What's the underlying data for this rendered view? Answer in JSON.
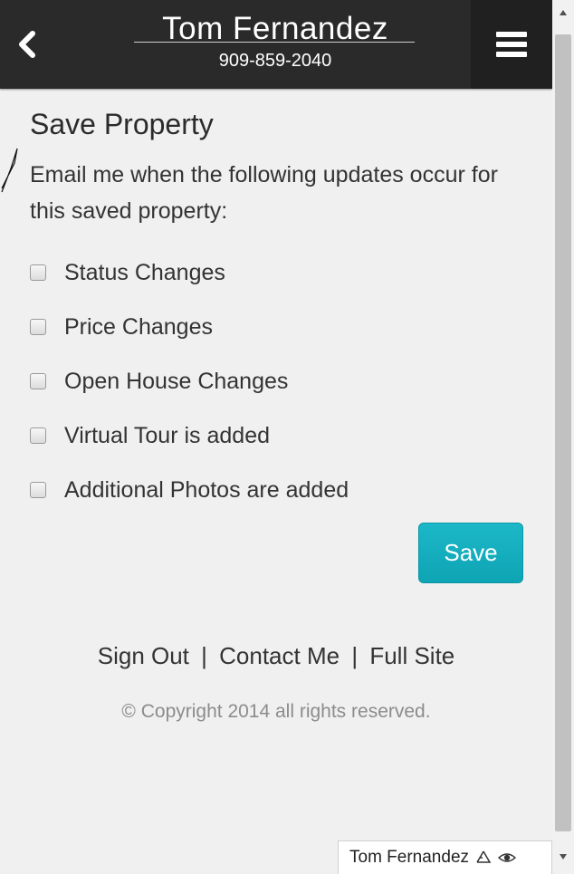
{
  "header": {
    "agent_name": "Tom Fernandez",
    "agent_phone": "909-859-2040",
    "back_icon": "chevron-left-icon",
    "menu_icon": "hamburger-icon"
  },
  "main": {
    "title": "Save Property",
    "intro": "Email me when the following updates occur for this saved property:",
    "options": [
      {
        "label": "Status Changes",
        "checked": false
      },
      {
        "label": "Price Changes",
        "checked": false
      },
      {
        "label": "Open House Changes",
        "checked": false
      },
      {
        "label": "Virtual Tour is added",
        "checked": false
      },
      {
        "label": "Additional Photos are added",
        "checked": false
      }
    ],
    "save_label": "Save"
  },
  "footer": {
    "sign_out": "Sign Out",
    "separator": "|",
    "contact_me": "Contact Me",
    "full_site": "Full Site",
    "copyright": "© Copyright 2014 all rights reserved."
  },
  "badge": {
    "name": "Tom Fernandez",
    "icons": [
      "recycle-icon",
      "eye-icon"
    ]
  },
  "colors": {
    "header_bg": "#2a2a2a",
    "page_bg": "#f0f0f0",
    "save_button": "#14aebe"
  }
}
